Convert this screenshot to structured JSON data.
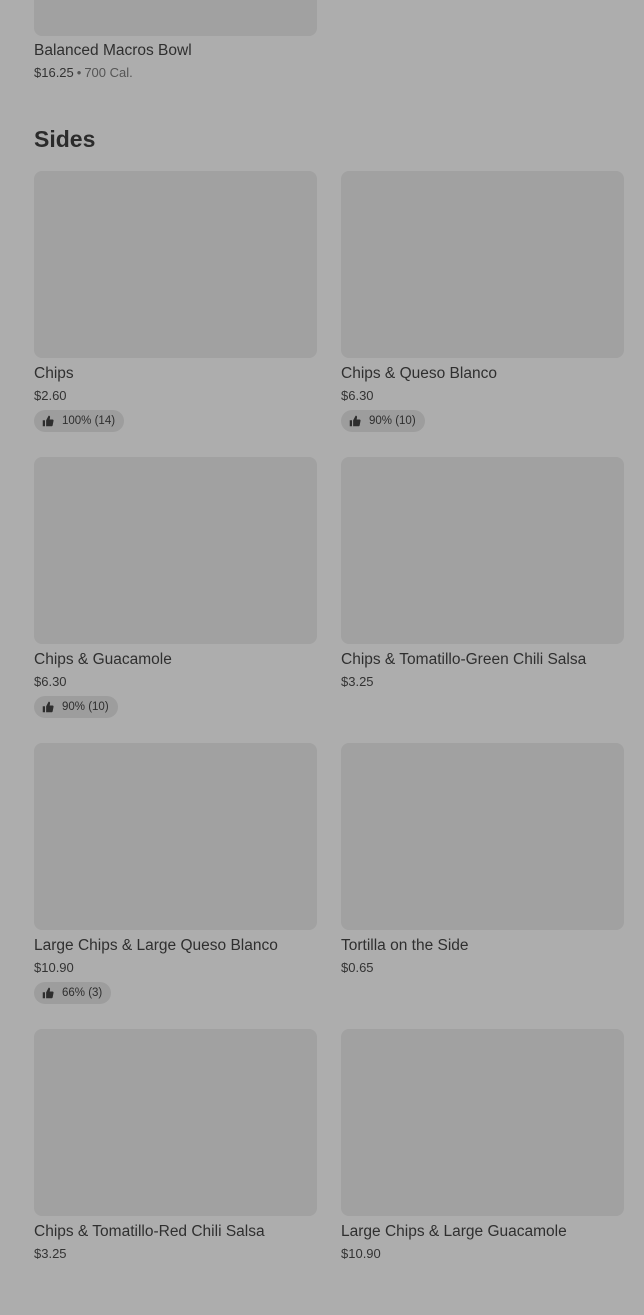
{
  "previous_item": {
    "name": "Balanced Macros Bowl",
    "price": "$16.25",
    "separator": "•",
    "calories": "700 Cal."
  },
  "section": {
    "title": "Sides"
  },
  "items": [
    {
      "name": "Chips",
      "price": "$2.60",
      "rating": "100% (14)"
    },
    {
      "name": "Chips & Queso Blanco",
      "price": "$6.30",
      "rating": "90% (10)"
    },
    {
      "name": "Chips & Guacamole",
      "price": "$6.30",
      "rating": "90% (10)"
    },
    {
      "name": "Chips & Tomatillo-Green Chili Salsa",
      "price": "$3.25",
      "rating": null
    },
    {
      "name": "Large Chips & Large Queso Blanco",
      "price": "$10.90",
      "rating": "66% (3)"
    },
    {
      "name": "Tortilla on the Side",
      "price": "$0.65",
      "rating": null
    },
    {
      "name": "Chips & Tomatillo-Red Chili Salsa",
      "price": "$3.25",
      "rating": null
    },
    {
      "name": "Large Chips & Large Guacamole",
      "price": "$10.90",
      "rating": null
    }
  ],
  "icons": {
    "rating": "thumbs-up-icon"
  },
  "colors": {
    "background": "#adadad",
    "placeholder_image": "#a1a1a1",
    "rating_pill": "#9d9d9d",
    "text": "#2e2e2e"
  }
}
